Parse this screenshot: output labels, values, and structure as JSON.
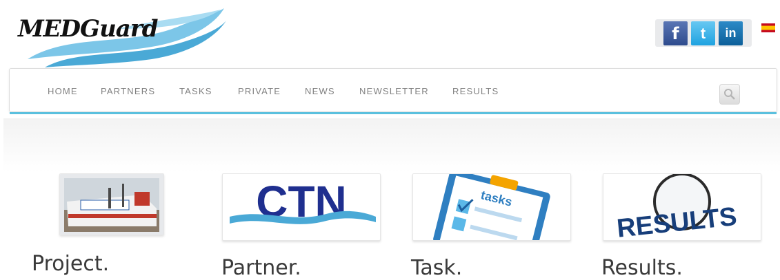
{
  "logo": {
    "text": "MEDGuard"
  },
  "social": {
    "facebook": "f",
    "twitter": "t",
    "linkedin": "in"
  },
  "nav": {
    "items": [
      "HOME",
      "PARTNERS",
      "TASKS",
      "PRIVATE",
      "NEWS",
      "NEWSLETTER",
      "RESULTS"
    ]
  },
  "cards": [
    {
      "caption": "Project.",
      "image_alt": ""
    },
    {
      "caption": "Partner.",
      "image_text": "CTN"
    },
    {
      "caption": "Task.",
      "image_text": "tasks"
    },
    {
      "caption": "Results.",
      "image_text": "RESULTS"
    }
  ],
  "colors": {
    "accent": "#5bc0de",
    "nav_text": "#808080",
    "logo_wave": "#5ab4dc"
  }
}
